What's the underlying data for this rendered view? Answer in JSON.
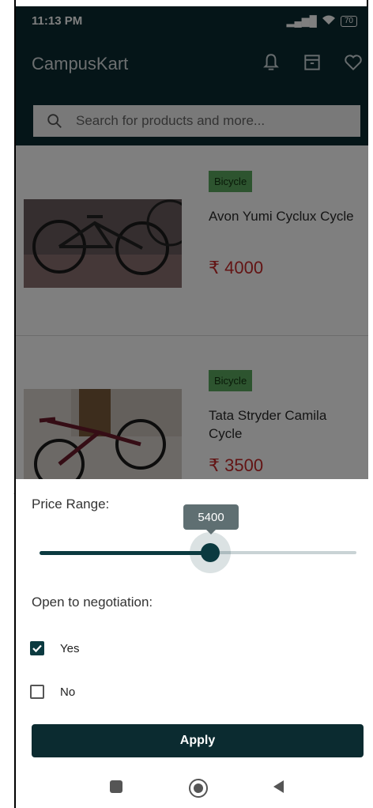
{
  "status": {
    "time": "11:13 PM",
    "battery": "70"
  },
  "app": {
    "title": "CampusKart"
  },
  "icons": {
    "notifications": "bell-icon",
    "orders": "archive-box-icon",
    "wishlist": "heart-icon",
    "search": "search-icon"
  },
  "search": {
    "placeholder": "Search for products and more..."
  },
  "products": [
    {
      "category": "Bicycle",
      "name": "Avon Yumi Cyclux Cycle",
      "price": "₹ 4000"
    },
    {
      "category": "Bicycle",
      "name": "Tata Stryder Camila Cycle",
      "price": "₹ 3500"
    }
  ],
  "filter": {
    "price_label": "Price Range:",
    "price_value": "5400",
    "price_fraction": 0.53,
    "negotiation_label": "Open to negotiation:",
    "options": [
      {
        "label": "Yes",
        "checked": true
      },
      {
        "label": "No",
        "checked": false
      }
    ],
    "apply_label": "Apply"
  },
  "colors": {
    "primary": "#0b2b30",
    "price": "#c62828",
    "badge": "#5aa85e"
  }
}
